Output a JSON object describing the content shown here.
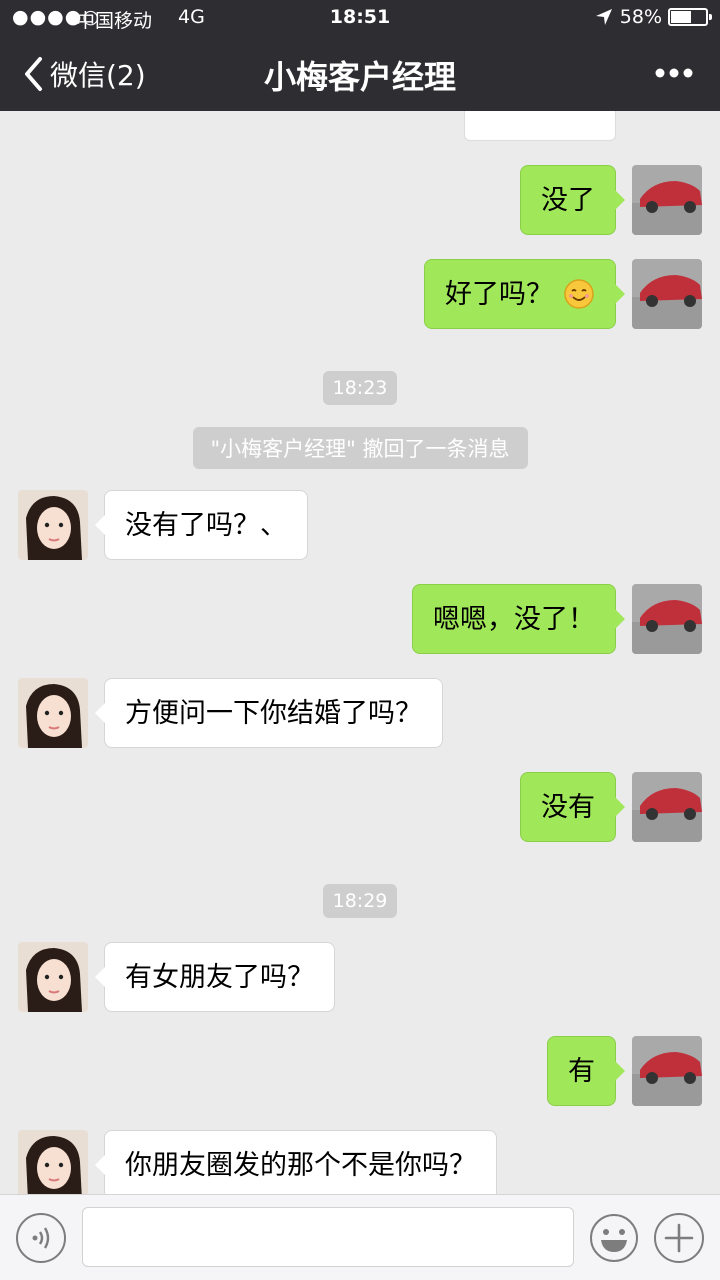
{
  "status_bar": {
    "signal": "●●●●○",
    "carrier": "中国移动",
    "network": "4G",
    "time": "18:51",
    "battery": "58%",
    "battery_level": 0.58
  },
  "nav": {
    "back_label": "微信(2)",
    "title": "小梅客户经理"
  },
  "messages": [
    {
      "side": "right",
      "text": "没了"
    },
    {
      "side": "right",
      "text": "好了吗？",
      "emoji": "smiling-face-emoji"
    },
    {
      "type": "timestamp",
      "text": "18:23"
    },
    {
      "type": "system",
      "text": "\"小梅客户经理\" 撤回了一条消息"
    },
    {
      "side": "left",
      "text": "没有了吗？、"
    },
    {
      "side": "right",
      "text": "嗯嗯，没了！"
    },
    {
      "side": "left",
      "text": "方便问一下你结婚了吗？"
    },
    {
      "side": "right",
      "text": "没有"
    },
    {
      "type": "timestamp",
      "text": "18:29"
    },
    {
      "side": "left",
      "text": "有女朋友了吗？"
    },
    {
      "side": "right",
      "text": "有"
    },
    {
      "side": "left",
      "text": "你朋友圈发的那个不是你吗？"
    }
  ],
  "input_bar": {
    "text_value": "",
    "voice_icon": "voice-icon",
    "emoji_icon": "emoji-icon",
    "add_icon": "plus-icon"
  },
  "colors": {
    "nav_bg": "#2e2e32",
    "chat_bg": "#ebebeb",
    "sent_bubble": "#a0e75a",
    "received_bubble": "#ffffff"
  }
}
